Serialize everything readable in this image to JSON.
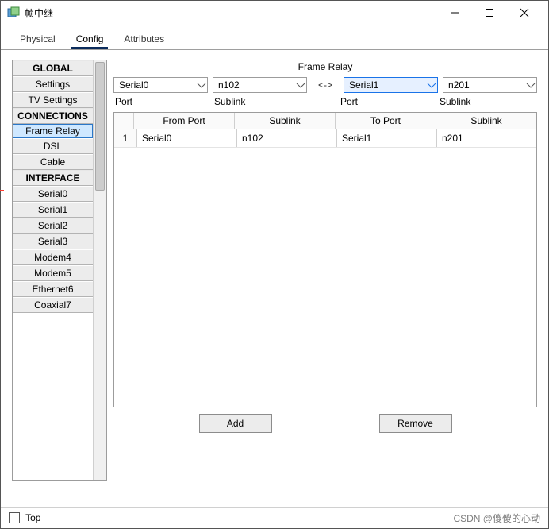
{
  "window": {
    "title": "帧中继"
  },
  "tabs": {
    "physical": "Physical",
    "config": "Config",
    "attributes": "Attributes"
  },
  "sidebar": {
    "groups": [
      {
        "header": "GLOBAL",
        "items": [
          "Settings",
          "TV Settings"
        ]
      },
      {
        "header": "CONNECTIONS",
        "items": [
          "Frame Relay",
          "DSL",
          "Cable"
        ]
      },
      {
        "header": "INTERFACE",
        "items": [
          "Serial0",
          "Serial1",
          "Serial2",
          "Serial3",
          "Modem4",
          "Modem5",
          "Ethernet6",
          "Coaxial7"
        ]
      }
    ],
    "selected": "Frame Relay"
  },
  "main": {
    "heading": "Frame Relay",
    "from_port": "Serial0",
    "from_sublink": "n102",
    "bidir": "<->",
    "to_port": "Serial1",
    "to_sublink": "n201",
    "label_port": "Port",
    "label_sublink": "Sublink",
    "cols": {
      "from_port": "From Port",
      "sublink_a": "Sublink",
      "to_port": "To Port",
      "sublink_b": "Sublink"
    },
    "rows": [
      {
        "idx": "1",
        "from_port": "Serial0",
        "sublink_a": "n102",
        "to_port": "Serial1",
        "sublink_b": "n201"
      }
    ],
    "add": "Add",
    "remove": "Remove"
  },
  "footer": {
    "top_checkbox": "Top",
    "watermark": "CSDN @傻傻的心动"
  }
}
